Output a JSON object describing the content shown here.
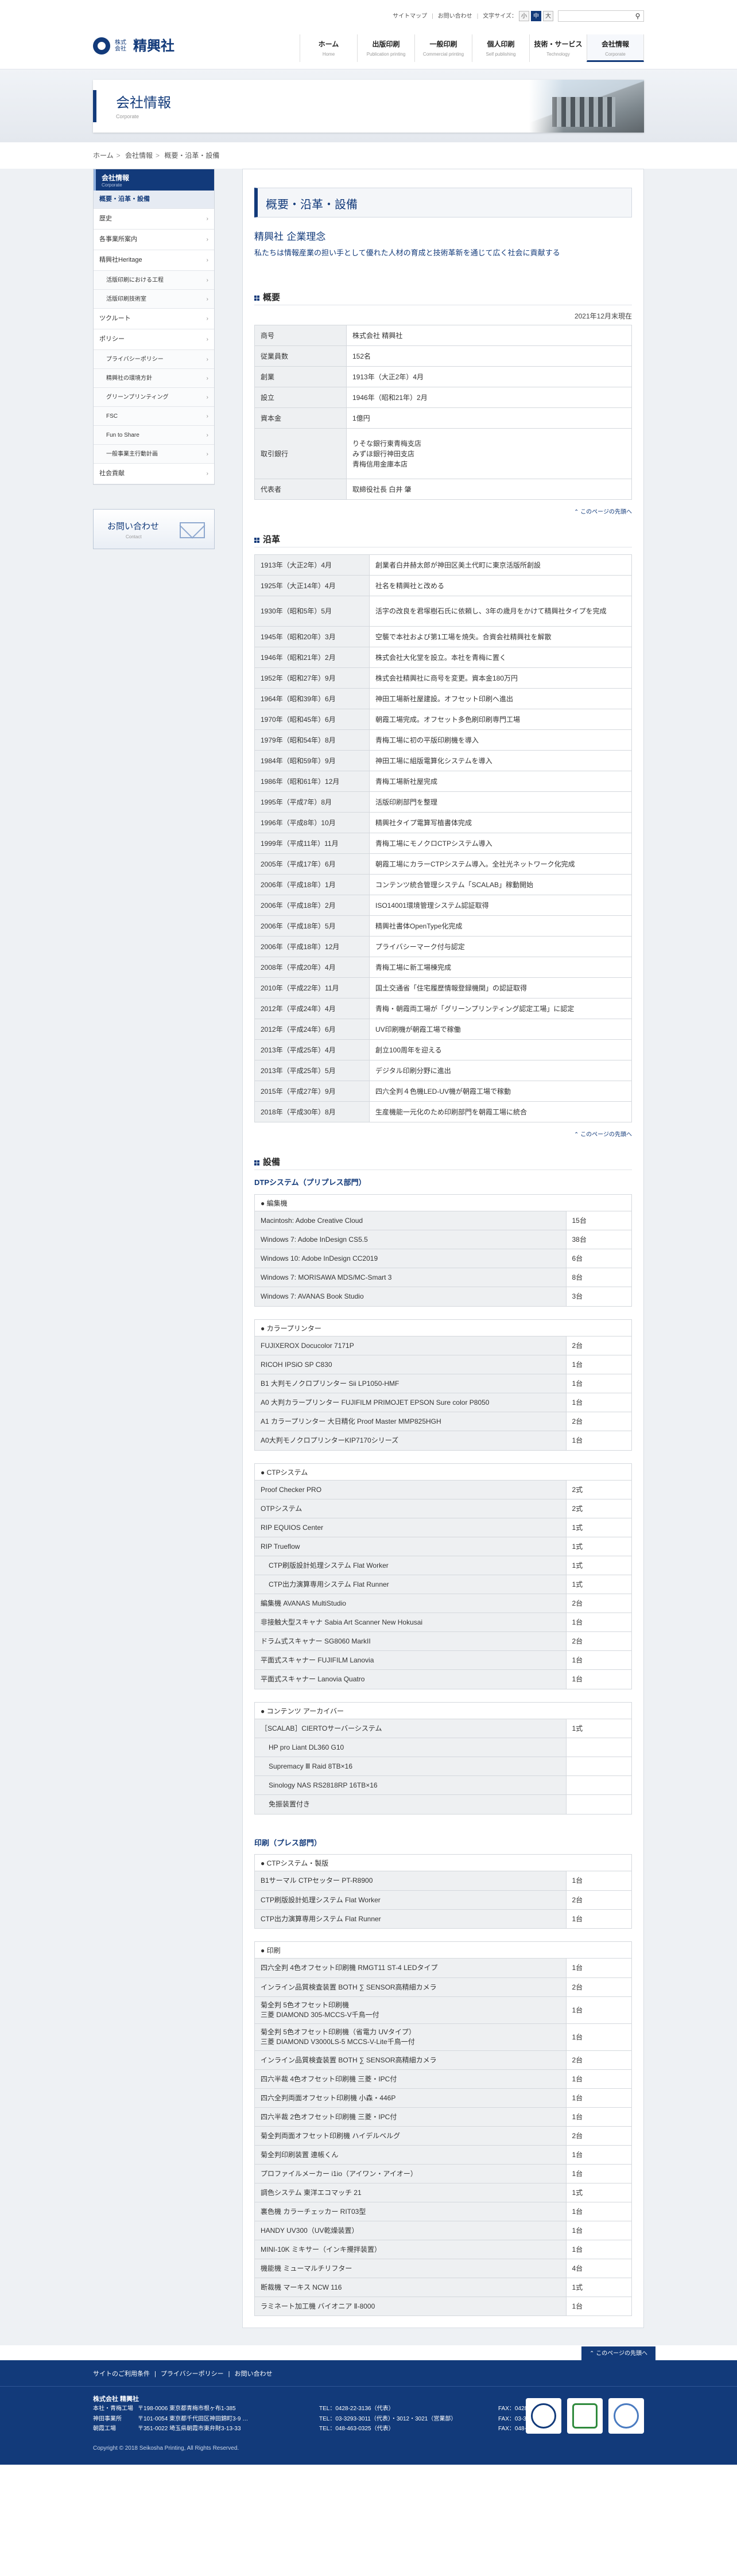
{
  "header": {
    "company_sub": "株式会社",
    "company_name": "精興社",
    "utility": {
      "sitemap": "サイトマップ",
      "contact": "お問い合わせ",
      "font_size_label": "文字サイズ：",
      "font_small": "小",
      "font_medium": "中",
      "font_large": "大",
      "search_placeholder": "",
      "search_icon": "search-icon"
    },
    "nav": [
      {
        "jp": "ホーム",
        "en": "Home"
      },
      {
        "jp": "出版印刷",
        "en": "Publication printing"
      },
      {
        "jp": "一般印刷",
        "en": "Commercial printing"
      },
      {
        "jp": "個人印刷",
        "en": "Self publishing"
      },
      {
        "jp": "技術・サービス",
        "en": "Technology"
      },
      {
        "jp": "会社情報",
        "en": "Corporate"
      }
    ]
  },
  "hero": {
    "title": "会社情報",
    "subtitle": "Corporate"
  },
  "breadcrumb": [
    "ホーム",
    "会社情報",
    "概要・沿革・設備"
  ],
  "sidebar": {
    "head_jp": "会社情報",
    "head_en": "Corporate",
    "items": [
      {
        "label": "概要・沿革・設備",
        "current": true
      },
      {
        "label": "歴史"
      },
      {
        "label": "各事業所案内"
      },
      {
        "label": "精興社Heritage"
      },
      {
        "label": "活版印刷における工程",
        "sub": true
      },
      {
        "label": "活版印刷技術室",
        "sub": true
      },
      {
        "label": "ツクルート"
      },
      {
        "label": "ポリシー"
      },
      {
        "label": "プライバシーポリシー",
        "sub": true
      },
      {
        "label": "精興社の環境方針",
        "sub": true
      },
      {
        "label": "グリーンプリンティング",
        "sub": true
      },
      {
        "label": "FSC",
        "sub": true
      },
      {
        "label": "Fun to Share",
        "sub": true
      },
      {
        "label": "一般事業主行動計画",
        "sub": true
      },
      {
        "label": "社会貢献"
      }
    ],
    "contact_jp": "お問い合わせ",
    "contact_en": "Contact"
  },
  "content": {
    "page_title": "概要・沿革・設備",
    "philosophy_title": "精興社 企業理念",
    "philosophy_text": "私たちは情報産業の担い手として優れた人材の育成と技術革新を通じて広く社会に貢献する",
    "overview_heading": "概要",
    "overview_date": "2021年12月末現在",
    "overview": [
      {
        "k": "商号",
        "v": [
          "株式会社 精興社"
        ]
      },
      {
        "k": "従業員数",
        "v": [
          "152名"
        ]
      },
      {
        "k": "創業",
        "v": [
          "1913年（大正2年）4月"
        ]
      },
      {
        "k": "設立",
        "v": [
          "1946年（昭和21年）2月"
        ]
      },
      {
        "k": "資本金",
        "v": [
          "1億円"
        ]
      },
      {
        "k": "取引銀行",
        "v": [
          "りそな銀行東青梅支店",
          "みずほ銀行神田支店",
          "青梅信用金庫本店"
        ]
      },
      {
        "k": "代表者",
        "v": [
          "取締役社長 白井 肇"
        ]
      }
    ],
    "pagetop_label": "このページの先頭へ",
    "history_heading": "沿革",
    "history": [
      {
        "k": "1913年（大正2年）4月",
        "v": "創業者白井赫太郎が神田区美土代町に東京活版所創設"
      },
      {
        "k": "1925年（大正14年）4月",
        "v": "社名を精興社と改める"
      },
      {
        "k": "1930年（昭和5年）5月",
        "v": "活字の改良を君塚樹石氏に依頼し、3年の歳月をかけて精興社タイプを完成",
        "multi": true
      },
      {
        "k": "1945年（昭和20年）3月",
        "v": "空襲で本社および第1工場を焼失。合資会社精興社を解散"
      },
      {
        "k": "1946年（昭和21年）2月",
        "v": "株式会社大化堂を設立。本社を青梅に置く"
      },
      {
        "k": "1952年（昭和27年）9月",
        "v": "株式会社精興社に商号を変更。資本金180万円"
      },
      {
        "k": "1964年（昭和39年）6月",
        "v": "神田工場新社屋建設。オフセット印刷へ進出"
      },
      {
        "k": "1970年（昭和45年）6月",
        "v": "朝霞工場完成。オフセット多色刷印刷専門工場"
      },
      {
        "k": "1979年（昭和54年）8月",
        "v": "青梅工場に初の平版印刷機を導入"
      },
      {
        "k": "1984年（昭和59年）9月",
        "v": "神田工場に組版電算化システムを導入"
      },
      {
        "k": "1986年（昭和61年）12月",
        "v": "青梅工場新社屋完成"
      },
      {
        "k": "1995年（平成7年）8月",
        "v": "活版印刷部門を整理"
      },
      {
        "k": "1996年（平成8年）10月",
        "v": "精興社タイプ電算写植書体完成"
      },
      {
        "k": "1999年（平成11年）11月",
        "v": "青梅工場にモノクロCTPシステム導入"
      },
      {
        "k": "2005年（平成17年）6月",
        "v": "朝霞工場にカラーCTPシステム導入。全社光ネットワーク化完成"
      },
      {
        "k": "2006年（平成18年）1月",
        "v": "コンテンツ統合管理システム「SCALAB」稼動開始"
      },
      {
        "k": "2006年（平成18年）2月",
        "v": "ISO14001環境管理システム認証取得"
      },
      {
        "k": "2006年（平成18年）5月",
        "v": "精興社書体OpenType化完成"
      },
      {
        "k": "2006年（平成18年）12月",
        "v": "プライバシーマーク付与認定"
      },
      {
        "k": "2008年（平成20年）4月",
        "v": "青梅工場に新工場棟完成"
      },
      {
        "k": "2010年（平成22年）11月",
        "v": "国土交通省「住宅履歴情報登録機関」の認証取得"
      },
      {
        "k": "2012年（平成24年）4月",
        "v": "青梅・朝霞両工場が「グリーンプリンティング認定工場」に認定"
      },
      {
        "k": "2012年（平成24年）6月",
        "v": "UV印刷機が朝霞工場で稼働"
      },
      {
        "k": "2013年（平成25年）4月",
        "v": "創立100周年を迎える"
      },
      {
        "k": "2013年（平成25年）5月",
        "v": "デジタル印刷分野に進出"
      },
      {
        "k": "2015年（平成27年）9月",
        "v": "四六全判４色機LED-UV機が朝霞工場で稼動"
      },
      {
        "k": "2018年（平成30年）8月",
        "v": "生産機能一元化のため印刷部門を朝霞工場に統合"
      }
    ],
    "equipment_heading": "設備",
    "dtp_title": "DTPシステム（プリプレス部門）",
    "print_title": "印刷（プレス部門）",
    "dtp_groups": [
      {
        "cap": "● 編集機",
        "rows": [
          {
            "k": "Macintosh: Adobe Creative Cloud",
            "v": "15台"
          },
          {
            "k": "Windows 7: Adobe InDesign CS5.5",
            "v": "38台"
          },
          {
            "k": "Windows 10: Adobe InDesign CC2019",
            "v": "6台"
          },
          {
            "k": "Windows 7: MORISAWA MDS/MC-Smart 3",
            "v": "8台"
          },
          {
            "k": "Windows 7: AVANAS Book Studio",
            "v": "3台"
          }
        ]
      },
      {
        "cap": "● カラープリンター",
        "rows": [
          {
            "k": "FUJIXEROX Docucolor 7171P",
            "v": "2台"
          },
          {
            "k": "RICOH IPSiO SP C830",
            "v": "1台"
          },
          {
            "k": "B1 大判モノクロプリンター Sii LP1050-HMF",
            "v": "1台"
          },
          {
            "k": "A0 大判カラープリンター FUJIFILM PRIMOJET EPSON Sure color P8050",
            "v": "1台"
          },
          {
            "k": "A1 カラープリンター 大日精化 Proof Master MMP825HGH",
            "v": "2台"
          },
          {
            "k": "A0大判モノクロプリンターKIP7170シリーズ",
            "v": "1台"
          }
        ]
      },
      {
        "cap": "● CTPシステム",
        "rows": [
          {
            "k": "Proof Checker PRO",
            "v": "2式"
          },
          {
            "k": "OTPシステム",
            "v": "2式"
          },
          {
            "k": "RIP EQUIOS Center",
            "v": "1式"
          },
          {
            "k": "RIP Trueflow",
            "v": "1式"
          },
          {
            "k": "CTP刷版設計処理システム Flat Worker",
            "v": "1式",
            "ind": true
          },
          {
            "k": "CTP出力演算専用システム Flat Runner",
            "v": "1式",
            "ind": true
          },
          {
            "k": "編集機 AVANAS MultiStudio",
            "v": "2台"
          },
          {
            "k": "非接触大型スキャナ Sabia Art Scanner New Hokusai",
            "v": "1台"
          },
          {
            "k": "ドラム式スキャナー SG8060 MarkII",
            "v": "2台"
          },
          {
            "k": "平面式スキャナー FUJIFILM Lanovia",
            "v": "1台"
          },
          {
            "k": "平面式スキャナー Lanovia Quatro",
            "v": "1台"
          }
        ]
      },
      {
        "cap": "● コンテンツ アーカイバー",
        "rows": [
          {
            "k": "［SCALAB］CIERTOサーバーシステム",
            "v": "1式"
          },
          {
            "k": "HP pro Liant DL360 G10",
            "v": "",
            "ind": true
          },
          {
            "k": "Supremacy Ⅲ Raid 8TB×16",
            "v": "",
            "ind": true
          },
          {
            "k": "Sinology NAS RS2818RP 16TB×16",
            "v": "",
            "ind": true
          },
          {
            "k": "免振装置付き",
            "v": "",
            "ind": true
          }
        ]
      }
    ],
    "print_groups": [
      {
        "cap": "● CTPシステム・製版",
        "rows": [
          {
            "k": "B1サーマル CTPセッター PT-R8900",
            "v": "1台"
          },
          {
            "k": "CTP刷版設計処理システム Flat Worker",
            "v": "2台"
          },
          {
            "k": "CTP出力演算専用システム Flat Runner",
            "v": "1台"
          }
        ]
      },
      {
        "cap": "● 印刷",
        "rows": [
          {
            "k": "四六全判 4色オフセット印刷機 RMGT11 ST-4 LEDタイプ",
            "v": "1台"
          },
          {
            "k": "インライン品質検査装置 BOTH ∑ SENSOR高精細カメラ",
            "v": "2台"
          },
          {
            "k": "菊全判 5色オフセット印刷機\n三菱 DIAMOND 305-MCCS-V千鳥一付",
            "v": "1台",
            "two": true
          },
          {
            "k": "菊全判 5色オフセット印刷機（省電力 UVタイプ）\n三菱 DIAMOND V3000LS-5 MCCS-V-Lite千鳥一付",
            "v": "1台",
            "two": true
          },
          {
            "k": "インライン品質検査装置 BOTH ∑ SENSOR高精細カメラ",
            "v": "2台"
          },
          {
            "k": "四六半裁 4色オフセット印刷機 三菱・IPC付",
            "v": "1台"
          },
          {
            "k": "四六全判両面オフセット印刷機 小森・446P",
            "v": "1台"
          },
          {
            "k": "四六半裁 2色オフセット印刷機 三菱・IPC付",
            "v": "1台"
          },
          {
            "k": "菊全判両面オフセット印刷機 ハイデルベルグ",
            "v": "2台"
          },
          {
            "k": "菊全判印刷装置 連帳くん",
            "v": "1台"
          },
          {
            "k": "プロファイルメーカー i1io（アイワン・アイオー）",
            "v": "1台"
          },
          {
            "k": "調色システム 東洋エコマッチ 21",
            "v": "1式"
          },
          {
            "k": "裏色機 カラーチェッカー RIT03型",
            "v": "1台"
          },
          {
            "k": "HANDY UV300（UV乾燥装置）",
            "v": "1台"
          },
          {
            "k": "MINI-10K ミキサー（インキ攪拌装置）",
            "v": "1台"
          },
          {
            "k": "機能機 ミューマルチリフター",
            "v": "4台"
          },
          {
            "k": "断裁機 マーキス NCW 116",
            "v": "1式"
          },
          {
            "k": "ラミネート加工機 バイオニア Ⅱ-8000",
            "v": "1台"
          }
        ]
      }
    ]
  },
  "footer": {
    "pagetop": "このページの先頭へ",
    "links": [
      "サイトのご利用条件",
      "プライバシーポリシー",
      "お問い合わせ"
    ],
    "company": "株式会社 精興社",
    "offices": [
      {
        "name": "本社・青梅工場",
        "addr": "〒198-0006 東京都青梅市根ヶ布1-385",
        "tel": "TEL：0428-22-3136（代表）",
        "fax": "FAX：0428-23-7114"
      },
      {
        "name": "神田事業所",
        "addr": "〒101-0054 東京都千代田区神田錦町3-9 …",
        "tel": "TEL：03-3293-3011（代表）・3012・3021（営業部）",
        "fax": "FAX：03-3293-7889"
      },
      {
        "name": "朝霞工場",
        "addr": "〒351-0022 埼玉県朝霞市東弁財3-13-33",
        "tel": "TEL：048-463-0325（代表）",
        "fax": "FAX：048-464-0722"
      }
    ],
    "copyright": "Copyright © 2018 Seikosha Printing, All Rights Reserved."
  }
}
